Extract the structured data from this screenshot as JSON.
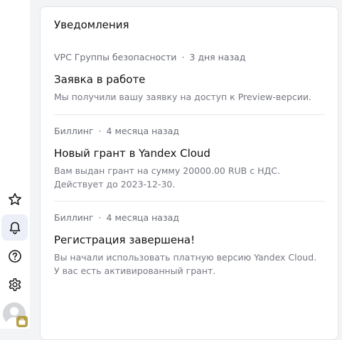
{
  "sidebar": {
    "items": [
      {
        "icon": "star-icon"
      },
      {
        "icon": "bell-icon",
        "active": true
      },
      {
        "icon": "help-icon"
      },
      {
        "icon": "gear-icon"
      }
    ],
    "avatar": {
      "icon": "avatar",
      "badge_icon": "briefcase-icon"
    }
  },
  "panel": {
    "title": "Уведомления",
    "notifications": [
      {
        "source": "VPC Группы безопасности",
        "separator": "·",
        "time": "3 дня назад",
        "title": "Заявка в работе",
        "text": "Мы получили вашу заявку на доступ к Preview-версии."
      },
      {
        "source": "Биллинг",
        "separator": "·",
        "time": "4 месяца назад",
        "title": "Новый грант в Yandex Cloud",
        "text": "Вам выдан грант на сумму 20000.00 RUB с НДС. Действует до 2023-12-30."
      },
      {
        "source": "Биллинг",
        "separator": "·",
        "time": "4 месяца назад",
        "title": "Регистрация завершена!",
        "text": "Вы начали использовать платную версию Yandex Cloud. У вас есть активированный грант."
      }
    ]
  },
  "colors": {
    "page_bg": "#f3f4f6",
    "active_item_bg": "#eceff7",
    "meta_text": "#6b6f78",
    "badge": "#b5a04a"
  }
}
